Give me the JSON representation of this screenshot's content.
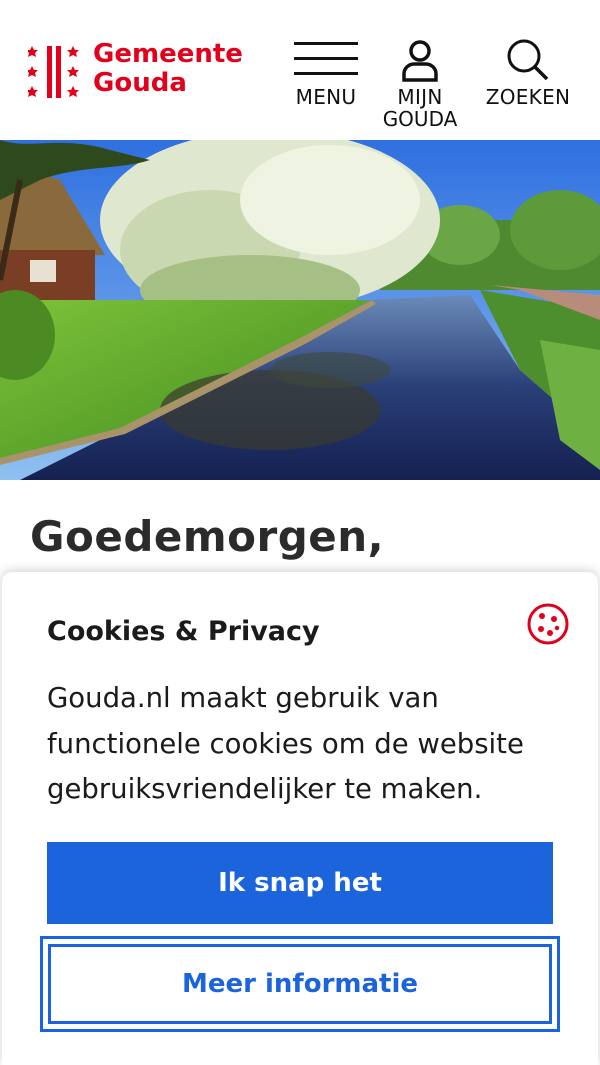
{
  "header": {
    "logo": {
      "line1": "Gemeente",
      "line2": "Gouda",
      "icon": "gouda-logo-mark",
      "color": "#e3001b"
    },
    "nav": [
      {
        "label": "MENU",
        "icon": "hamburger-icon"
      },
      {
        "label_line1": "MIJN",
        "label_line2": "GOUDA",
        "icon": "user-icon"
      },
      {
        "label": "ZOEKEN",
        "icon": "search-icon"
      }
    ]
  },
  "hero": {
    "image": "canal-landscape-photo"
  },
  "main": {
    "greeting": "Goedemorgen,"
  },
  "cookie_dialog": {
    "title": "Cookies & Privacy",
    "icon": "cookie-icon",
    "body": "Gouda.nl maakt gebruik van functionele cookies om de website gebruiksvriendelijker te maken.",
    "primary_button": "Ik snap het",
    "secondary_button": "Meer informatie",
    "accent_color": "#1b64dc"
  }
}
